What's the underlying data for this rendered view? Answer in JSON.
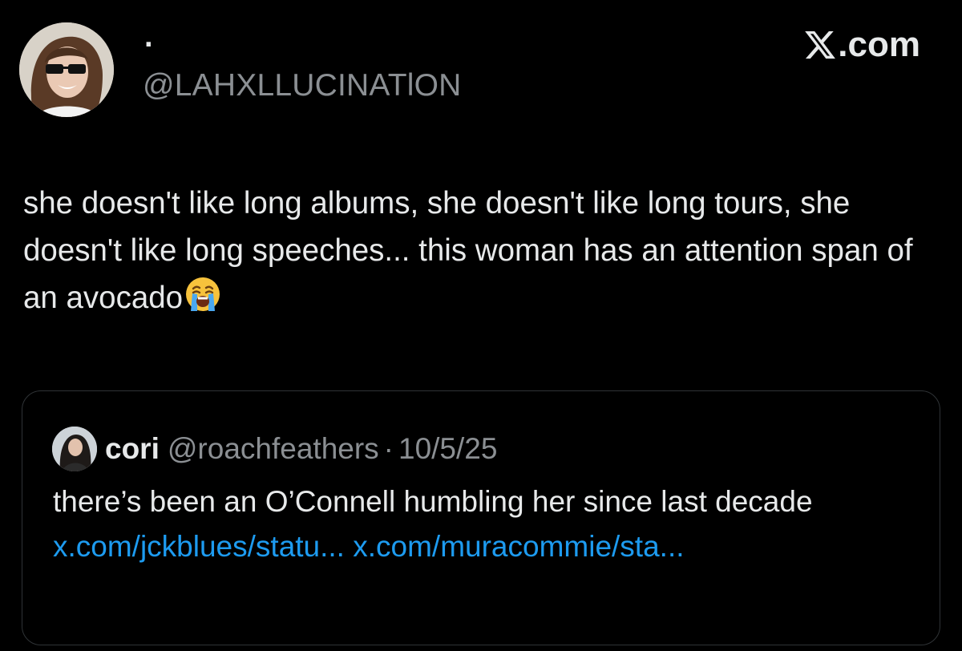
{
  "author": {
    "display_name": "·",
    "handle": "@LAHXLLUCINATlON"
  },
  "brand": {
    "text": ".com",
    "icon": "x-logo-icon"
  },
  "tweet": {
    "text": "she doesn't like long albums, she doesn't like long tours, she doesn't like long speeches... this woman has an attention span of an avocado",
    "emoji": "loudly-crying-face-icon"
  },
  "quoted_tweet": {
    "name": "cori",
    "handle": "@roachfeathers",
    "separator": "·",
    "date": "10/5/25",
    "text": "there’s been an O’Connell humbling her since last decade",
    "link_1": "x.com/jckblues/statu...",
    "link_2": "x.com/muracommie/sta..."
  },
  "colors": {
    "background": "#000000",
    "text": "#e7e9ea",
    "secondary_text": "#8b8f93",
    "link": "#1d9bf0",
    "border": "#2f3336"
  }
}
